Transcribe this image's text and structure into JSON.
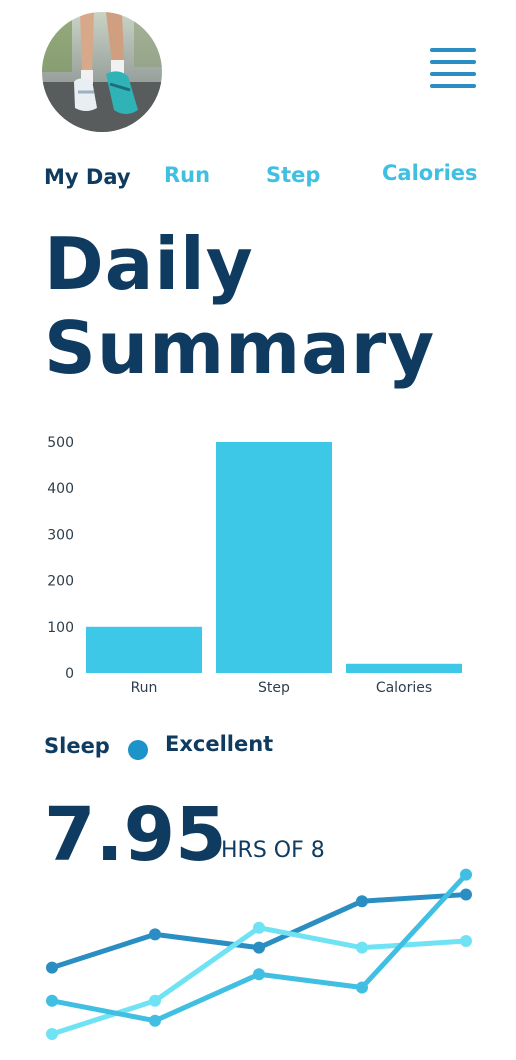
{
  "tabs": [
    {
      "label": "My Day",
      "active": true
    },
    {
      "label": "Run",
      "active": false
    },
    {
      "label": "Step",
      "active": false
    },
    {
      "label": "Calories",
      "active": false
    }
  ],
  "title_line1": "Daily",
  "title_line2": "Summary",
  "chart_data": {
    "type": "bar",
    "categories": [
      "Run",
      "Step",
      "Calories"
    ],
    "values": [
      100,
      500,
      20
    ],
    "ylim": [
      0,
      500
    ],
    "yticks": [
      "0",
      "100",
      "200",
      "300",
      "400",
      "500"
    ],
    "bar_color": "#3ec8e8",
    "grid": false
  },
  "sleep": {
    "label": "Sleep",
    "status": "Excellent",
    "status_color": "#1d94c9",
    "hours": "7.95",
    "unit_text": "HRS OF 8"
  },
  "trend_lines": [
    {
      "color": "#2a8ec2",
      "values": [
        2.0,
        3.0,
        2.6,
        4.0,
        4.2
      ]
    },
    {
      "color": "#6fe3f3",
      "values": [
        0.0,
        1.0,
        3.2,
        2.6,
        2.8
      ]
    },
    {
      "color": "#41bfe2",
      "values": [
        1.0,
        0.4,
        1.8,
        1.4,
        4.8
      ]
    }
  ],
  "colors": {
    "primary": "#0e3b5f",
    "accent": "#3fc0e2",
    "menu": "#2a8ec2"
  },
  "icons": {
    "menu": "hamburger-menu-icon",
    "avatar": "runner-shoes-photo"
  }
}
